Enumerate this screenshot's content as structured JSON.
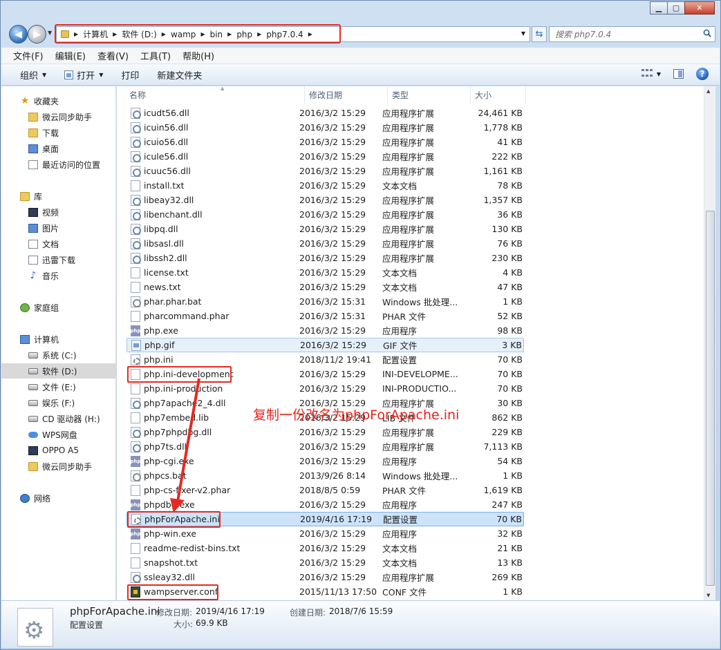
{
  "window": {
    "minimize": "▁",
    "maximize": "▢",
    "close": "✕"
  },
  "address": {
    "crumbs": [
      "计算机",
      "软件 (D:)",
      "wamp",
      "bin",
      "php",
      "php7.0.4"
    ]
  },
  "search": {
    "placeholder": "搜索 php7.0.4"
  },
  "menu": [
    "文件(F)",
    "编辑(E)",
    "查看(V)",
    "工具(T)",
    "帮助(H)"
  ],
  "toolbar": {
    "organize": "组织",
    "open": "打开",
    "print": "打印",
    "new_folder": "新建文件夹"
  },
  "sidebar": {
    "favorites": {
      "label": "收藏夹",
      "items": [
        "微云同步助手",
        "下载",
        "桌面",
        "最近访问的位置"
      ]
    },
    "libraries": {
      "label": "库",
      "items": [
        "视频",
        "图片",
        "文档",
        "迅雷下载",
        "音乐"
      ]
    },
    "homegroup": "家庭组",
    "computer": {
      "label": "计算机",
      "items": [
        "系统 (C:)",
        "软件 (D:)",
        "文件 (E:)",
        "娱乐 (F:)",
        "CD 驱动器 (H:)",
        "WPS网盘",
        "OPPO A5",
        "微云同步助手"
      ]
    },
    "network": "网络"
  },
  "columns": {
    "name": "名称",
    "date": "修改日期",
    "type": "类型",
    "size": "大小"
  },
  "files": [
    {
      "name": "icudt56.dll",
      "date": "2016/3/2 15:29",
      "type": "应用程序扩展",
      "size": "24,461 KB",
      "icon": "dll"
    },
    {
      "name": "icuin56.dll",
      "date": "2016/3/2 15:29",
      "type": "应用程序扩展",
      "size": "1,778 KB",
      "icon": "dll"
    },
    {
      "name": "icuio56.dll",
      "date": "2016/3/2 15:29",
      "type": "应用程序扩展",
      "size": "41 KB",
      "icon": "dll"
    },
    {
      "name": "icule56.dll",
      "date": "2016/3/2 15:29",
      "type": "应用程序扩展",
      "size": "222 KB",
      "icon": "dll"
    },
    {
      "name": "icuuc56.dll",
      "date": "2016/3/2 15:29",
      "type": "应用程序扩展",
      "size": "1,161 KB",
      "icon": "dll"
    },
    {
      "name": "install.txt",
      "date": "2016/3/2 15:29",
      "type": "文本文档",
      "size": "78 KB",
      "icon": "txt"
    },
    {
      "name": "libeay32.dll",
      "date": "2016/3/2 15:29",
      "type": "应用程序扩展",
      "size": "1,357 KB",
      "icon": "dll"
    },
    {
      "name": "libenchant.dll",
      "date": "2016/3/2 15:29",
      "type": "应用程序扩展",
      "size": "36 KB",
      "icon": "dll"
    },
    {
      "name": "libpq.dll",
      "date": "2016/3/2 15:29",
      "type": "应用程序扩展",
      "size": "130 KB",
      "icon": "dll"
    },
    {
      "name": "libsasl.dll",
      "date": "2016/3/2 15:29",
      "type": "应用程序扩展",
      "size": "76 KB",
      "icon": "dll"
    },
    {
      "name": "libssh2.dll",
      "date": "2016/3/2 15:29",
      "type": "应用程序扩展",
      "size": "230 KB",
      "icon": "dll"
    },
    {
      "name": "license.txt",
      "date": "2016/3/2 15:29",
      "type": "文本文档",
      "size": "4 KB",
      "icon": "txt"
    },
    {
      "name": "news.txt",
      "date": "2016/3/2 15:29",
      "type": "文本文档",
      "size": "47 KB",
      "icon": "txt"
    },
    {
      "name": "phar.phar.bat",
      "date": "2016/3/2 15:31",
      "type": "Windows 批处理...",
      "size": "1 KB",
      "icon": "bat"
    },
    {
      "name": "pharcommand.phar",
      "date": "2016/3/2 15:31",
      "type": "PHAR 文件",
      "size": "52 KB",
      "icon": "txt"
    },
    {
      "name": "php.exe",
      "date": "2016/3/2 15:29",
      "type": "应用程序",
      "size": "98 KB",
      "icon": "exe"
    },
    {
      "name": "php.gif",
      "date": "2016/3/2 15:29",
      "type": "GIF 文件",
      "size": "3 KB",
      "icon": "gif"
    },
    {
      "name": "php.ini",
      "date": "2018/11/2 19:41",
      "type": "配置设置",
      "size": "70 KB",
      "icon": "ini"
    },
    {
      "name": "php.ini-development",
      "date": "2016/3/2 15:29",
      "type": "INI-DEVELOPME...",
      "size": "70 KB",
      "icon": "txt"
    },
    {
      "name": "php.ini-production",
      "date": "2016/3/2 15:29",
      "type": "INI-PRODUCTIO...",
      "size": "70 KB",
      "icon": "txt"
    },
    {
      "name": "php7apache2_4.dll",
      "date": "2016/3/2 15:29",
      "type": "应用程序扩展",
      "size": "30 KB",
      "icon": "dll"
    },
    {
      "name": "php7embed.lib",
      "date": "2016/3/2 15:29",
      "type": "LIB 文件",
      "size": "862 KB",
      "icon": "txt"
    },
    {
      "name": "php7phpdbg.dll",
      "date": "2016/3/2 15:29",
      "type": "应用程序扩展",
      "size": "229 KB",
      "icon": "dll"
    },
    {
      "name": "php7ts.dll",
      "date": "2016/3/2 15:29",
      "type": "应用程序扩展",
      "size": "7,113 KB",
      "icon": "dll"
    },
    {
      "name": "php-cgi.exe",
      "date": "2016/3/2 15:29",
      "type": "应用程序",
      "size": "54 KB",
      "icon": "exe"
    },
    {
      "name": "phpcs.bat",
      "date": "2013/9/26 8:14",
      "type": "Windows 批处理...",
      "size": "1 KB",
      "icon": "bat"
    },
    {
      "name": "php-cs-fixer-v2.phar",
      "date": "2018/8/5 0:59",
      "type": "PHAR 文件",
      "size": "1,619 KB",
      "icon": "txt"
    },
    {
      "name": "phpdbg.exe",
      "date": "2016/3/2 15:29",
      "type": "应用程序",
      "size": "247 KB",
      "icon": "exe"
    },
    {
      "name": "phpForApache.ini",
      "date": "2019/4/16 17:19",
      "type": "配置设置",
      "size": "70 KB",
      "icon": "ini"
    },
    {
      "name": "php-win.exe",
      "date": "2016/3/2 15:29",
      "type": "应用程序",
      "size": "32 KB",
      "icon": "exe"
    },
    {
      "name": "readme-redist-bins.txt",
      "date": "2016/3/2 15:29",
      "type": "文本文档",
      "size": "21 KB",
      "icon": "txt"
    },
    {
      "name": "snapshot.txt",
      "date": "2016/3/2 15:29",
      "type": "文本文档",
      "size": "13 KB",
      "icon": "txt"
    },
    {
      "name": "ssleay32.dll",
      "date": "2016/3/2 15:29",
      "type": "应用程序扩展",
      "size": "269 KB",
      "icon": "dll"
    },
    {
      "name": "wampserver.conf",
      "date": "2015/11/13 17:50",
      "type": "CONF 文件",
      "size": "1 KB",
      "icon": "conf"
    }
  ],
  "annotation": "复制一份改名为phpForApache.ini",
  "details": {
    "name": "phpForApache.ini",
    "type": "配置设置",
    "modified_label": "修改日期:",
    "modified_value": "2019/4/16 17:19",
    "size_label": "大小:",
    "size_value": "69.9 KB",
    "created_label": "创建日期:",
    "created_value": "2018/7/6 15:59"
  },
  "colors": {
    "annotation_red": "#e32a22",
    "selection": "#cce3fa"
  }
}
